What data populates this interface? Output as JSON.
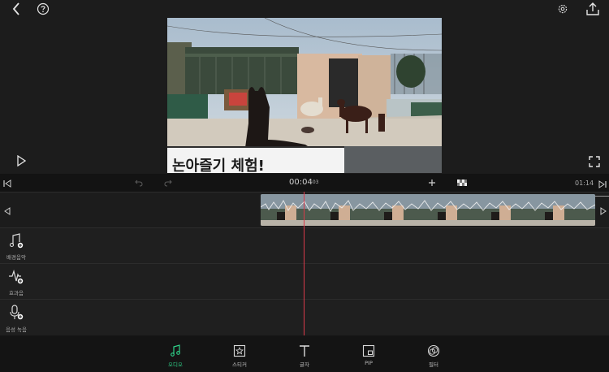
{
  "header": {
    "back_icon": "chevron-left-icon",
    "help_icon": "question-circle-icon",
    "settings_icon": "gear-icon",
    "share_icon": "upload-icon"
  },
  "timeline": {
    "current_time": "00:04",
    "current_frames": "03",
    "end_time": "01:14"
  },
  "tracks": [
    {
      "label": "배경음악",
      "icon": "music-note-add-icon"
    },
    {
      "label": "효과음",
      "icon": "waveform-add-icon"
    },
    {
      "label": "음성 녹음",
      "icon": "microphone-add-icon"
    }
  ],
  "toolbar": [
    {
      "label": "오디오",
      "icon": "music-note-icon",
      "active": true
    },
    {
      "label": "스티커",
      "icon": "star-square-icon",
      "active": false
    },
    {
      "label": "글자",
      "icon": "text-t-icon",
      "active": false
    },
    {
      "label": "PIP",
      "icon": "picture-in-picture-icon",
      "active": false
    },
    {
      "label": "필터",
      "icon": "filter-circles-icon",
      "active": false
    }
  ],
  "preview_sign_text": "논아즐기 체험!",
  "colors": {
    "accent": "#2fd38a",
    "playhead": "#d93a4a"
  }
}
